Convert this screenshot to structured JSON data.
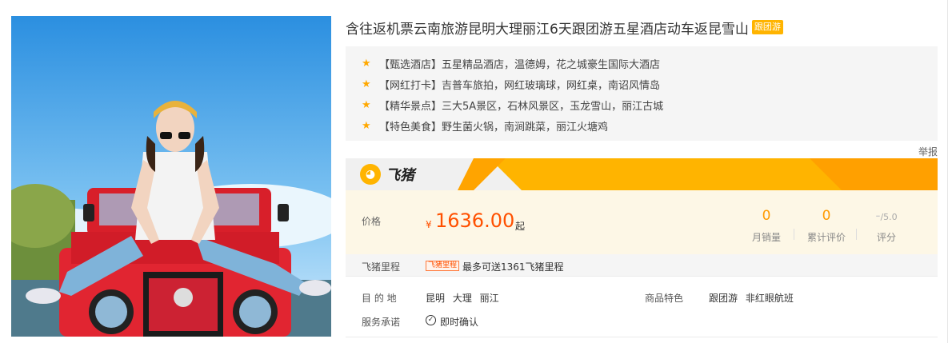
{
  "product": {
    "title": "含往返机票云南旅游昆明大理丽江6天跟团游五星酒店动车返昆雪山",
    "tag": "跟团游"
  },
  "features": [
    {
      "text": "【甄选酒店】五星精品酒店，温德姆，花之城豪生国际大酒店"
    },
    {
      "text": "【网红打卡】吉普车旅拍，网红玻璃球，网红桌，南诏风情岛"
    },
    {
      "text": "【精华景点】三大5A景区，石林风景区，玉龙雪山，丽江古城"
    },
    {
      "text": "【特色美食】野生菌火锅，南涧跳菜，丽江火塘鸡"
    }
  ],
  "report_label": "举报",
  "brand": {
    "name": "飞猪",
    "icon": "pig-logo-icon"
  },
  "price": {
    "label": "价格",
    "currency": "¥",
    "amount": "1636.00",
    "suffix": "起"
  },
  "stats": {
    "monthly_sales": {
      "value": "0",
      "label": "月销量"
    },
    "reviews": {
      "value": "0",
      "label": "累计评价"
    },
    "rating": {
      "value": "-",
      "max": "/5.0",
      "label": "评分"
    }
  },
  "mileage": {
    "label": "飞猪里程",
    "tag": "飞猪里程",
    "text": "最多可送1361飞猪里程"
  },
  "info": {
    "destination_label": "目 的 地",
    "destination_value": "昆明  大理  丽江",
    "feature_label": "商品特色",
    "feature_value": "跟团游  非红眼航班",
    "service_label": "服务承诺",
    "service_value": "即时确认"
  },
  "colors": {
    "accent": "#ff5000",
    "brand_yellow": "#ffb400",
    "stat_orange": "#ff9a00"
  }
}
